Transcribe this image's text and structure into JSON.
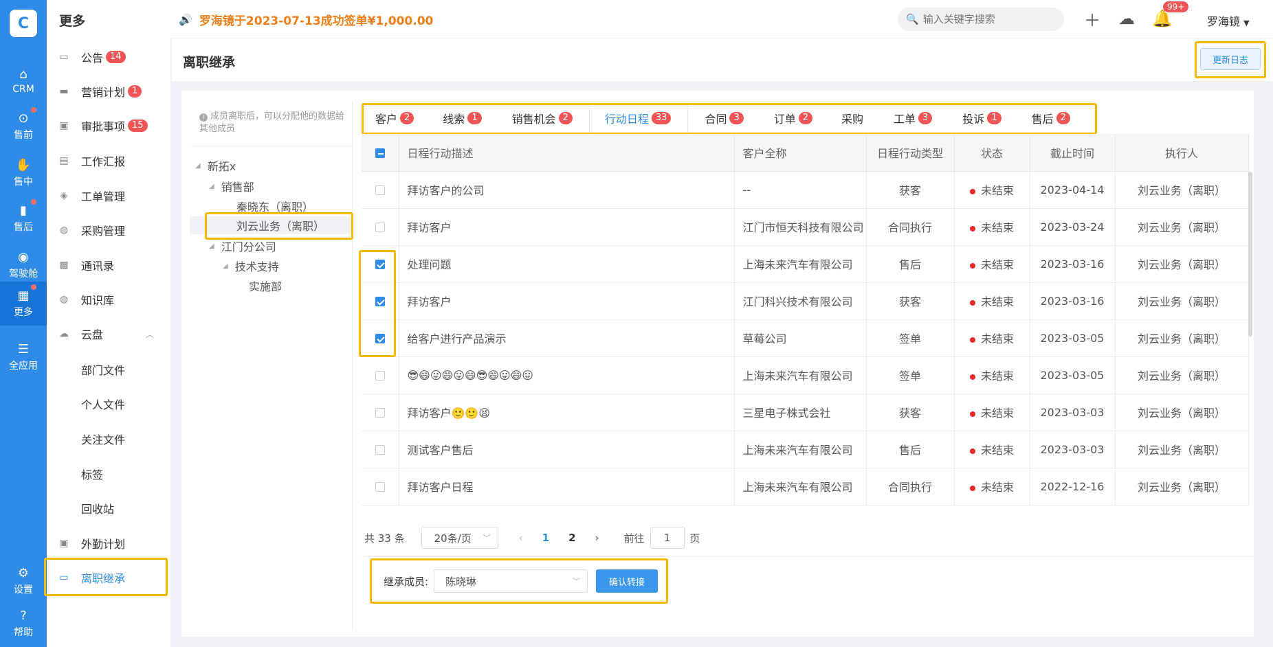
{
  "rail": {
    "items": [
      {
        "label": "CRM",
        "icon": "home-icon"
      },
      {
        "label": "售前",
        "icon": "pin-icon"
      },
      {
        "label": "售中",
        "icon": "handshake-icon"
      },
      {
        "label": "售后",
        "icon": "shield-icon"
      },
      {
        "label": "驾驶舱",
        "icon": "dashboard-icon"
      },
      {
        "label": "更多",
        "icon": "grid-icon"
      },
      {
        "label": "全应用",
        "icon": "menu-icon"
      },
      {
        "label": "设置",
        "icon": "gear-icon"
      },
      {
        "label": "帮助",
        "icon": "help-icon"
      }
    ]
  },
  "menu": {
    "title": "更多",
    "items": [
      {
        "label": "公告",
        "badge": "14"
      },
      {
        "label": "营销计划",
        "badge": "1"
      },
      {
        "label": "审批事项",
        "badge": "15"
      },
      {
        "label": "工作汇报"
      },
      {
        "label": "工单管理"
      },
      {
        "label": "采购管理"
      },
      {
        "label": "通讯录"
      },
      {
        "label": "知识库"
      },
      {
        "label": "云盘"
      },
      {
        "label": "部门文件"
      },
      {
        "label": "个人文件"
      },
      {
        "label": "关注文件"
      },
      {
        "label": "标签"
      },
      {
        "label": "回收站"
      },
      {
        "label": "外勤计划"
      },
      {
        "label": "离职继承"
      }
    ]
  },
  "topbar": {
    "notice": "罗海镜于2023-07-13成功签单¥1,000.00",
    "search_placeholder": "输入关键字搜索",
    "notify_badge": "99+",
    "user": "罗海镜"
  },
  "page": {
    "title": "离职继承",
    "log_button": "更新日志"
  },
  "tree": {
    "hint": "成员离职后，可以分配他的数据给其他成员",
    "nodes": [
      "新拓x",
      "销售部",
      "秦晓东（离职）",
      "刘云业务（离职）",
      "江门分公司",
      "技术支持",
      "实施部"
    ]
  },
  "tabs": [
    {
      "label": "客户",
      "badge": "2"
    },
    {
      "label": "线索",
      "badge": "1"
    },
    {
      "label": "销售机会",
      "badge": "2"
    },
    {
      "label": "行动日程",
      "badge": "33"
    },
    {
      "label": "合同",
      "badge": "3"
    },
    {
      "label": "订单",
      "badge": "2"
    },
    {
      "label": "采购",
      "badge": ""
    },
    {
      "label": "工单",
      "badge": "3"
    },
    {
      "label": "投诉",
      "badge": "1"
    },
    {
      "label": "售后",
      "badge": "2"
    }
  ],
  "table": {
    "headers": [
      "日程行动描述",
      "客户全称",
      "日程行动类型",
      "状态",
      "截止时间",
      "执行人"
    ],
    "rows": [
      {
        "checked": false,
        "desc": "拜访客户的公司",
        "customer": "--",
        "type": "获客",
        "status": "未结束",
        "due": "2023-04-14",
        "owner": "刘云业务（离职）"
      },
      {
        "checked": false,
        "desc": "拜访客户",
        "customer": "江门市恒天科技有限公司",
        "type": "合同执行",
        "status": "未结束",
        "due": "2023-03-24",
        "owner": "刘云业务（离职）"
      },
      {
        "checked": true,
        "desc": "处理问题",
        "customer": "上海未来汽车有限公司",
        "type": "售后",
        "status": "未结束",
        "due": "2023-03-16",
        "owner": "刘云业务（离职）"
      },
      {
        "checked": true,
        "desc": "拜访客户",
        "customer": "江门科兴技术有限公司",
        "type": "获客",
        "status": "未结束",
        "due": "2023-03-16",
        "owner": "刘云业务（离职）"
      },
      {
        "checked": true,
        "desc": "给客户进行产品演示",
        "customer": "草莓公司",
        "type": "签单",
        "status": "未结束",
        "due": "2023-03-05",
        "owner": "刘云业务（离职）"
      },
      {
        "checked": false,
        "desc": "😎😄😛😄😛😄😎😄😛😄😛",
        "customer": "上海未来汽车有限公司",
        "type": "签单",
        "status": "未结束",
        "due": "2023-03-05",
        "owner": "刘云业务（离职）"
      },
      {
        "checked": false,
        "desc": "拜访客户🙂🙂😫",
        "customer": "三星电子株式会社",
        "type": "获客",
        "status": "未结束",
        "due": "2023-03-03",
        "owner": "刘云业务（离职）"
      },
      {
        "checked": false,
        "desc": "测试客户售后",
        "customer": "上海未来汽车有限公司",
        "type": "售后",
        "status": "未结束",
        "due": "2023-03-03",
        "owner": "刘云业务（离职）"
      },
      {
        "checked": false,
        "desc": "拜访客户日程",
        "customer": "上海未来汽车有限公司",
        "type": "合同执行",
        "status": "未结束",
        "due": "2022-12-16",
        "owner": "刘云业务（离职）"
      }
    ]
  },
  "pager": {
    "total": "共 33 条",
    "page_size": "20条/页",
    "pages": [
      "1",
      "2"
    ],
    "goto_label": "前往",
    "goto_value": "1",
    "page_unit": "页"
  },
  "inherit": {
    "label": "继承成员:",
    "member": "陈晓琳",
    "confirm": "确认转接"
  }
}
